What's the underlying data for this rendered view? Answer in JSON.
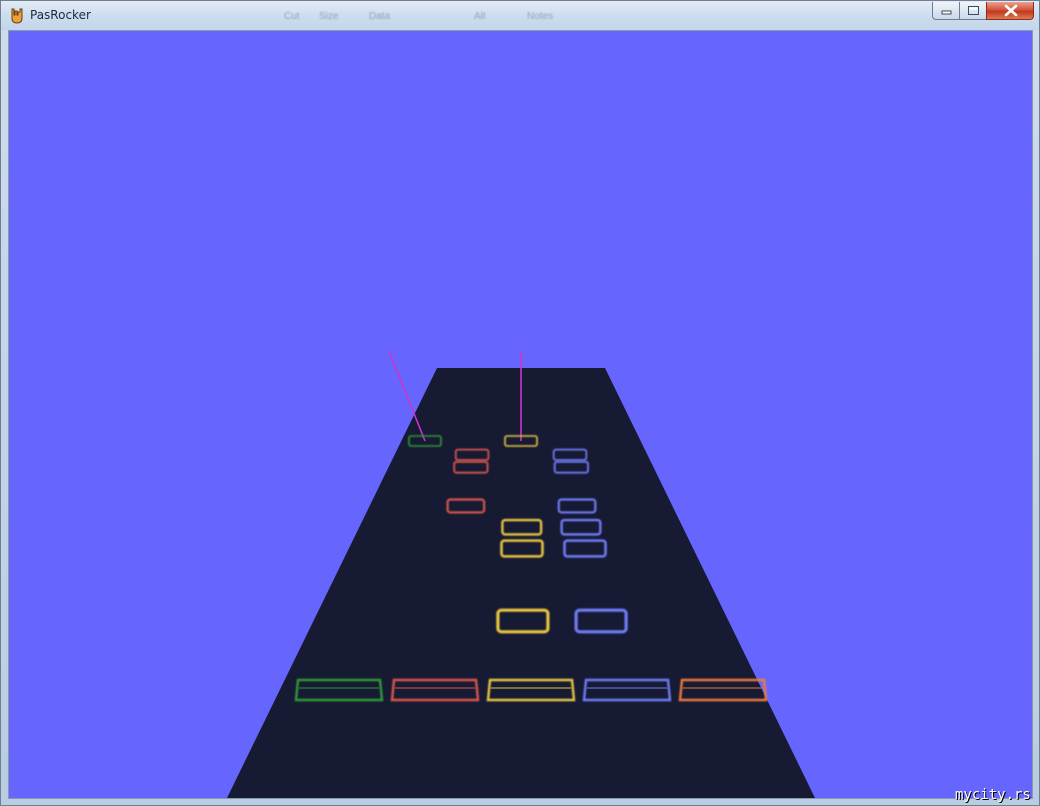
{
  "window": {
    "title": "PasRocker",
    "ghost_menu": [
      "Cut",
      "Size",
      "Data",
      "Alt",
      "Notes"
    ]
  },
  "colors": {
    "sky": "#6666ff",
    "highway": "#171a33",
    "green": "#2f9a35",
    "red": "#d9574c",
    "yellow": "#e8c640",
    "blue": "#6f7df5",
    "orange": "#e87a3c",
    "sustain": "#cc33cc"
  },
  "icons": {
    "app": "rock-hand-icon",
    "minimize": "minimize-icon",
    "maximize": "maximize-icon",
    "close": "close-icon"
  },
  "highway": {
    "lanes": [
      "green",
      "red",
      "yellow",
      "blue",
      "orange"
    ]
  },
  "notes": [
    {
      "lane": "green",
      "depth": 0.0,
      "sustain": true
    },
    {
      "lane": "yellow",
      "depth": 0.0,
      "sustain": true
    },
    {
      "lane": "red",
      "depth": 0.055
    },
    {
      "lane": "blue",
      "depth": 0.055
    },
    {
      "lane": "red",
      "depth": 0.105
    },
    {
      "lane": "blue",
      "depth": 0.105
    },
    {
      "lane": "red",
      "depth": 0.26
    },
    {
      "lane": "blue",
      "depth": 0.26
    },
    {
      "lane": "yellow",
      "depth": 0.345
    },
    {
      "lane": "blue",
      "depth": 0.345
    },
    {
      "lane": "yellow",
      "depth": 0.43
    },
    {
      "lane": "blue",
      "depth": 0.43
    },
    {
      "lane": "yellow",
      "depth": 0.72
    },
    {
      "lane": "blue",
      "depth": 0.72
    }
  ],
  "watermark": "mycity.rs"
}
